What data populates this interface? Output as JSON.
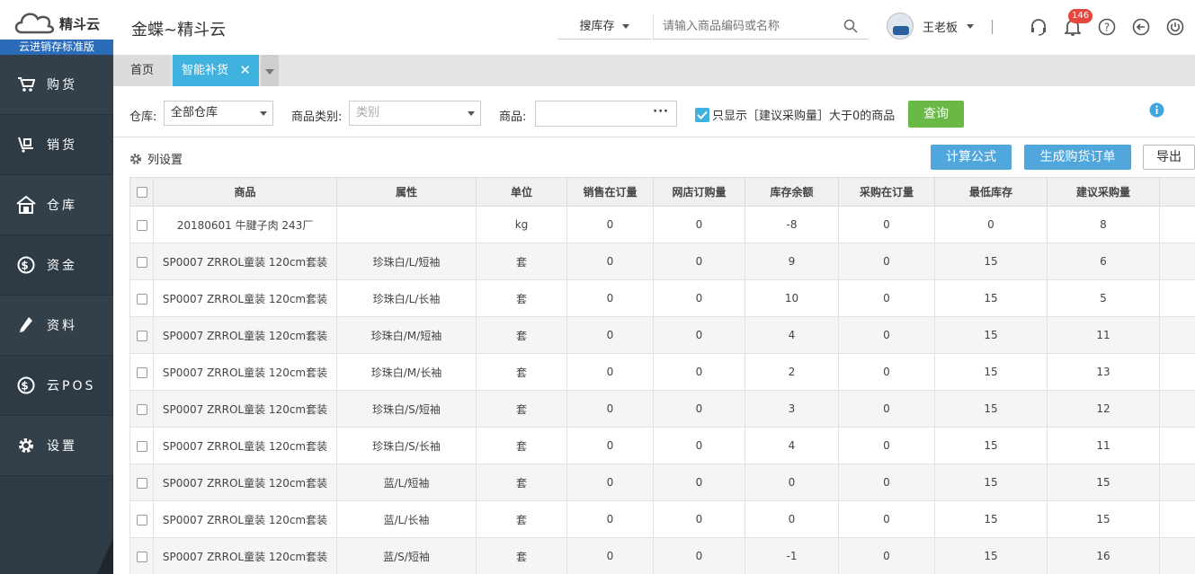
{
  "brand": {
    "name": "精斗云",
    "edition": "云进销存标准版"
  },
  "header": {
    "app_title": "金蝶~精斗云",
    "search_type": "搜库存",
    "search_placeholder": "请输入商品编码或名称",
    "user_name": "王老板",
    "notification_count": "146"
  },
  "sidebar": {
    "items": [
      {
        "label": "购货",
        "icon": "cart-icon"
      },
      {
        "label": "销货",
        "icon": "sales-icon"
      },
      {
        "label": "仓库",
        "icon": "warehouse-icon"
      },
      {
        "label": "资金",
        "icon": "dollar-icon"
      },
      {
        "label": "资料",
        "icon": "pencil-icon"
      },
      {
        "label": "云POS",
        "icon": "dollar-icon"
      },
      {
        "label": "设置",
        "icon": "gear-icon"
      }
    ]
  },
  "tabs": {
    "home": "首页",
    "active": "智能补货"
  },
  "filters": {
    "warehouse_label": "仓库:",
    "warehouse_value": "全部仓库",
    "category_label": "商品类别:",
    "category_placeholder": "类别",
    "product_label": "商品:",
    "only_show_label": "只显示［建议采购量］大于0的商品",
    "query_button": "查询"
  },
  "toolbar": {
    "column_settings": "列设置",
    "formula_button": "计算公式",
    "generate_button": "生成购货订单",
    "export_button": "导出"
  },
  "table": {
    "headers": [
      "商品",
      "属性",
      "单位",
      "销售在订量",
      "网店订购量",
      "库存余额",
      "采购在订量",
      "最低库存",
      "建议采购量"
    ],
    "rows": [
      [
        "20180601 牛腱子肉 243厂",
        "",
        "kg",
        "0",
        "0",
        "-8",
        "0",
        "0",
        "8"
      ],
      [
        "SP0007 ZRROL童装 120cm套装",
        "珍珠白/L/短袖",
        "套",
        "0",
        "0",
        "9",
        "0",
        "15",
        "6"
      ],
      [
        "SP0007 ZRROL童装 120cm套装",
        "珍珠白/L/长袖",
        "套",
        "0",
        "0",
        "10",
        "0",
        "15",
        "5"
      ],
      [
        "SP0007 ZRROL童装 120cm套装",
        "珍珠白/M/短袖",
        "套",
        "0",
        "0",
        "4",
        "0",
        "15",
        "11"
      ],
      [
        "SP0007 ZRROL童装 120cm套装",
        "珍珠白/M/长袖",
        "套",
        "0",
        "0",
        "2",
        "0",
        "15",
        "13"
      ],
      [
        "SP0007 ZRROL童装 120cm套装",
        "珍珠白/S/短袖",
        "套",
        "0",
        "0",
        "3",
        "0",
        "15",
        "12"
      ],
      [
        "SP0007 ZRROL童装 120cm套装",
        "珍珠白/S/长袖",
        "套",
        "0",
        "0",
        "4",
        "0",
        "15",
        "11"
      ],
      [
        "SP0007 ZRROL童装 120cm套装",
        "蓝/L/短袖",
        "套",
        "0",
        "0",
        "0",
        "0",
        "15",
        "15"
      ],
      [
        "SP0007 ZRROL童装 120cm套装",
        "蓝/L/长袖",
        "套",
        "0",
        "0",
        "0",
        "0",
        "15",
        "15"
      ],
      [
        "SP0007 ZRROL童装 120cm套装",
        "蓝/S/短袖",
        "套",
        "0",
        "0",
        "-1",
        "0",
        "15",
        "16"
      ]
    ]
  },
  "colors": {
    "sidebar": "#2f3b44",
    "accent_blue": "#3fb2e0",
    "query_green": "#6ab845",
    "badge_red": "#e5473d"
  }
}
